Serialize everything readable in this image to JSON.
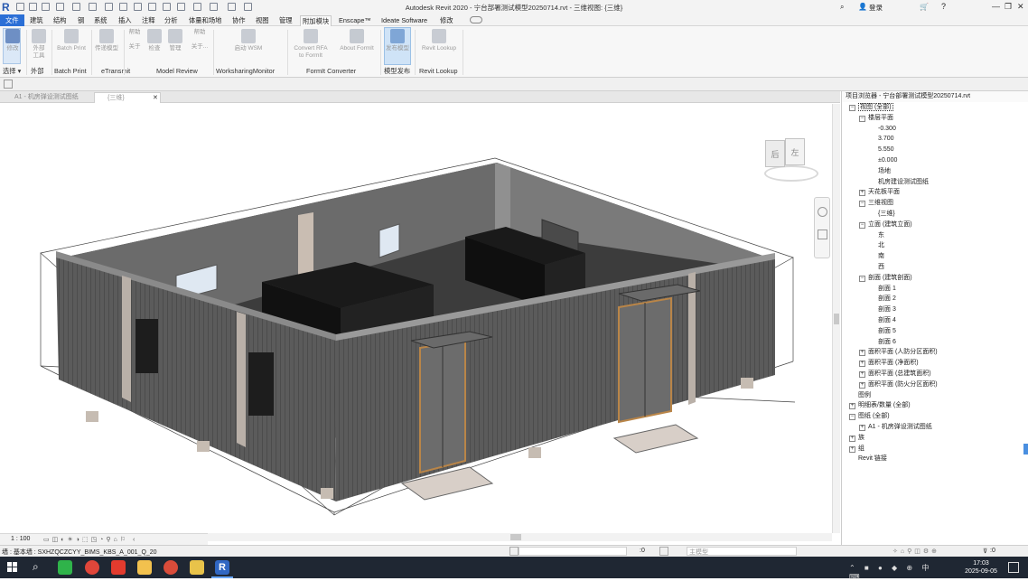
{
  "window": {
    "title": "Autodesk Revit 2020 - 宁台部署测试模型20250714.rvt - 三维视图: {三维}",
    "signin_label": "登录",
    "minimize": "—",
    "restore": "❐",
    "close": "✕"
  },
  "tabs": [
    "文件",
    "建筑",
    "结构",
    "钢",
    "系统",
    "插入",
    "注释",
    "分析",
    "体量和场地",
    "协作",
    "视图",
    "管理",
    "附加模块",
    "Enscape™",
    "Ideate Software",
    "修改"
  ],
  "active_tab": "附加模块",
  "ribbon": {
    "buttons": [
      {
        "label": "修改",
        "sub": ""
      },
      {
        "label": "外部",
        "sub": "工具"
      },
      {
        "label": "Batch Print",
        "sub": ""
      },
      {
        "label": "传递模型",
        "sub": ""
      },
      {
        "label": "帮助",
        "sub": "关于"
      },
      {
        "label": "检查",
        "sub": "检查"
      },
      {
        "label": "管理",
        "sub": "管理"
      },
      {
        "label": "帮助",
        "sub": "关于..."
      },
      {
        "label": "启动 WSM",
        "sub": ""
      },
      {
        "label": "Convert RFA",
        "sub": "to FormIt"
      },
      {
        "label": "About FormIt",
        "sub": ""
      },
      {
        "label": "发布模型",
        "sub": ""
      },
      {
        "label": "Revit Lookup",
        "sub": ""
      }
    ],
    "panels": [
      "选择 ▾",
      "外部",
      "Batch Print",
      "eTransmit",
      "Model Review",
      "WorksharingMonitor",
      "FormIt Converter",
      "模型发布",
      "Revit Lookup"
    ]
  },
  "doc_tabs": [
    {
      "label": "A1 - 机房弹设测试图纸",
      "active": false
    },
    {
      "label": "{三维}",
      "active": true,
      "close": "✕"
    }
  ],
  "browser": {
    "title": "项目浏览器 - 宁台部署测试模型20250714.rvt",
    "items": [
      {
        "label": "视图 (全部)",
        "level": 0,
        "toggle": "−",
        "selected": true
      },
      {
        "label": "楼层平面",
        "level": 1,
        "toggle": "−"
      },
      {
        "label": "-0.300",
        "level": 2,
        "toggle": ""
      },
      {
        "label": "3.700",
        "level": 2,
        "toggle": ""
      },
      {
        "label": "5.550",
        "level": 2,
        "toggle": ""
      },
      {
        "label": "±0.000",
        "level": 2,
        "toggle": ""
      },
      {
        "label": "场地",
        "level": 2,
        "toggle": ""
      },
      {
        "label": "机房建设测试图纸",
        "level": 2,
        "toggle": ""
      },
      {
        "label": "天花板平面",
        "level": 1,
        "toggle": "+"
      },
      {
        "label": "三维视图",
        "level": 1,
        "toggle": "−"
      },
      {
        "label": "{三维}",
        "level": 2,
        "toggle": ""
      },
      {
        "label": "立面 (建筑立面)",
        "level": 1,
        "toggle": "−"
      },
      {
        "label": "东",
        "level": 2,
        "toggle": ""
      },
      {
        "label": "北",
        "level": 2,
        "toggle": ""
      },
      {
        "label": "南",
        "level": 2,
        "toggle": ""
      },
      {
        "label": "西",
        "level": 2,
        "toggle": ""
      },
      {
        "label": "剖面 (建筑剖面)",
        "level": 1,
        "toggle": "−"
      },
      {
        "label": "剖面 1",
        "level": 2,
        "toggle": ""
      },
      {
        "label": "剖面 2",
        "level": 2,
        "toggle": ""
      },
      {
        "label": "剖面 3",
        "level": 2,
        "toggle": ""
      },
      {
        "label": "剖面 4",
        "level": 2,
        "toggle": ""
      },
      {
        "label": "剖面 5",
        "level": 2,
        "toggle": ""
      },
      {
        "label": "剖面 6",
        "level": 2,
        "toggle": ""
      },
      {
        "label": "面积平面 (人防分区面积)",
        "level": 1,
        "toggle": "+"
      },
      {
        "label": "面积平面 (净面积)",
        "level": 1,
        "toggle": "+"
      },
      {
        "label": "面积平面 (总建筑面积)",
        "level": 1,
        "toggle": "+"
      },
      {
        "label": "面积平面 (防火分区面积)",
        "level": 1,
        "toggle": "+"
      },
      {
        "label": "图例",
        "level": 0,
        "toggle": ""
      },
      {
        "label": "明细表/数量 (全部)",
        "level": 0,
        "toggle": "+"
      },
      {
        "label": "图纸 (全部)",
        "level": 0,
        "toggle": "−"
      },
      {
        "label": "A1 - 机房弹设测试图纸",
        "level": 1,
        "toggle": "+"
      },
      {
        "label": "族",
        "level": 0,
        "toggle": "+"
      },
      {
        "label": "组",
        "level": 0,
        "toggle": "+"
      },
      {
        "label": "Revit 链接",
        "level": 0,
        "toggle": ""
      }
    ]
  },
  "viewbar": {
    "scale": "1 : 100"
  },
  "viewcube": {
    "left": "后",
    "right": "左"
  },
  "status": {
    "text": "墙 : 基本墙 : SXHZQCZCYY_BIMS_KBS_A_001_Q_20",
    "workset": ":0",
    "model": "主模型",
    "filter": ":0"
  },
  "clock": {
    "time": "17:03",
    "date": "2025-09-05"
  },
  "colors": {
    "file_tab": "#2b6fd6",
    "ribbon_bg": "#f7f7f7",
    "taskbar": "#1f2733",
    "wall": "#5a5a5a"
  }
}
